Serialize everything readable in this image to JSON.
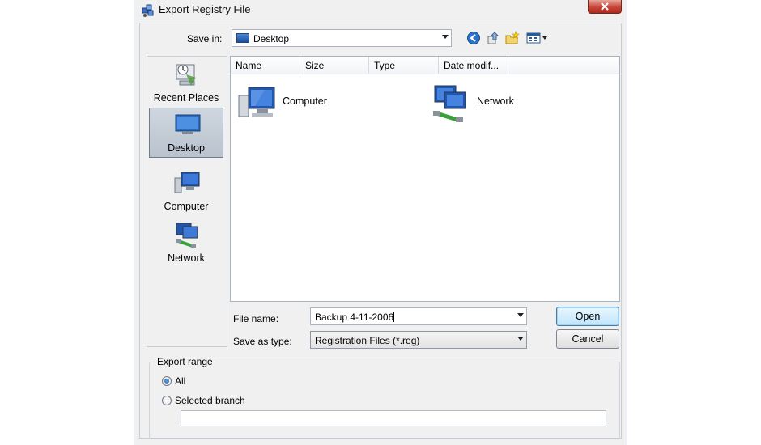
{
  "dialog": {
    "title": "Export Registry File",
    "icon": "registry-editor-icon"
  },
  "toolbar": {
    "save_in_label": "Save in:",
    "save_in_value": "Desktop",
    "icons": [
      "back-icon",
      "up-folder-icon",
      "new-folder-icon",
      "views-menu-icon"
    ]
  },
  "places": [
    {
      "label": "Recent Places",
      "icon": "recent-places-icon",
      "selected": false
    },
    {
      "label": "Desktop",
      "icon": "desktop-icon",
      "selected": true
    },
    {
      "label": "Computer",
      "icon": "computer-icon",
      "selected": false
    },
    {
      "label": "Network",
      "icon": "network-icon",
      "selected": false
    }
  ],
  "file_list": {
    "columns": [
      "Name",
      "Size",
      "Type",
      "Date modif..."
    ],
    "items": [
      {
        "label": "Computer",
        "icon": "computer-icon"
      },
      {
        "label": "Network",
        "icon": "network-icon"
      }
    ]
  },
  "form": {
    "file_name_label": "File name:",
    "file_name_value": "Backup 4-11-2006",
    "save_as_type_label": "Save as type:",
    "save_as_type_value": "Registration Files (*.reg)"
  },
  "buttons": {
    "open": "Open",
    "cancel": "Cancel"
  },
  "export_range": {
    "title": "Export range",
    "options": [
      {
        "label": "All",
        "selected": true
      },
      {
        "label": "Selected branch",
        "selected": false
      }
    ],
    "branch_value": ""
  }
}
